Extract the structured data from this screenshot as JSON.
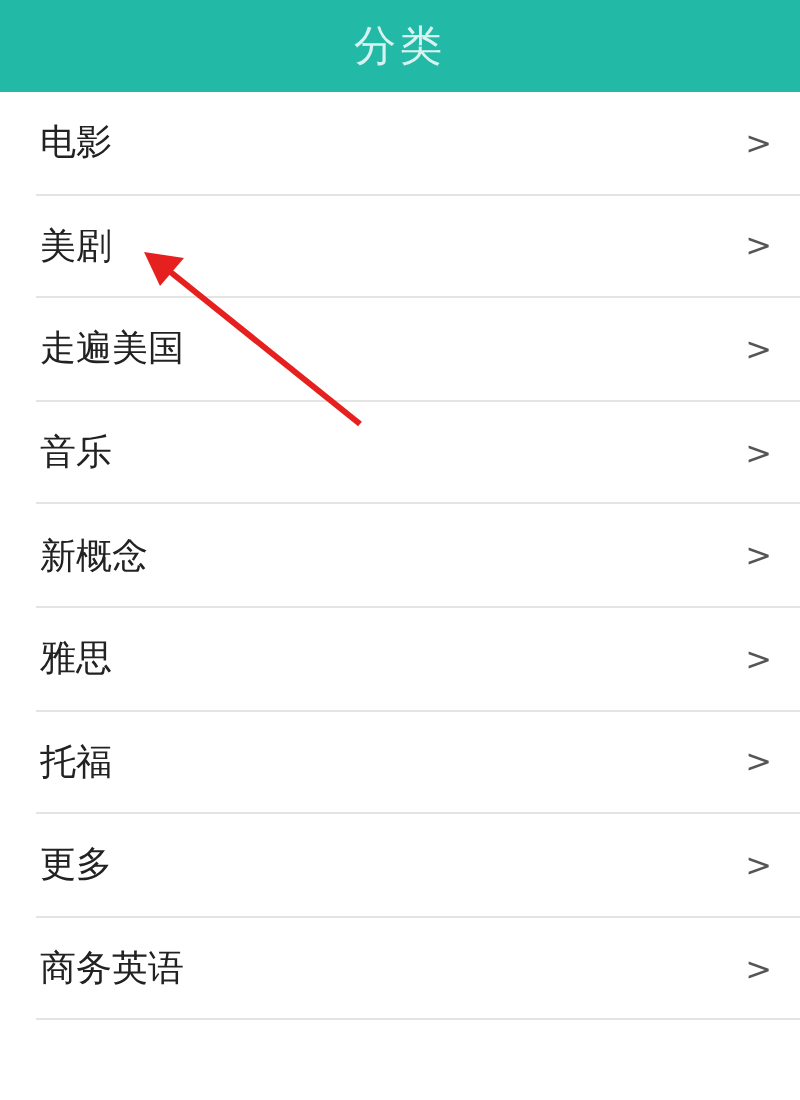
{
  "header": {
    "title": "分类"
  },
  "items": [
    {
      "label": "电影",
      "chevron": ">",
      "pointed_at": false
    },
    {
      "label": "美剧",
      "chevron": ">",
      "pointed_at": true
    },
    {
      "label": "走遍美国",
      "chevron": ">",
      "pointed_at": false
    },
    {
      "label": "音乐",
      "chevron": ">",
      "pointed_at": false
    },
    {
      "label": "新概念",
      "chevron": ">",
      "pointed_at": false
    },
    {
      "label": "雅思",
      "chevron": ">",
      "pointed_at": false
    },
    {
      "label": "托福",
      "chevron": ">",
      "pointed_at": false
    },
    {
      "label": "更多",
      "chevron": ">",
      "pointed_at": false
    },
    {
      "label": "商务英语",
      "chevron": ">",
      "pointed_at": false
    }
  ],
  "annotation": {
    "kind": "arrow"
  }
}
